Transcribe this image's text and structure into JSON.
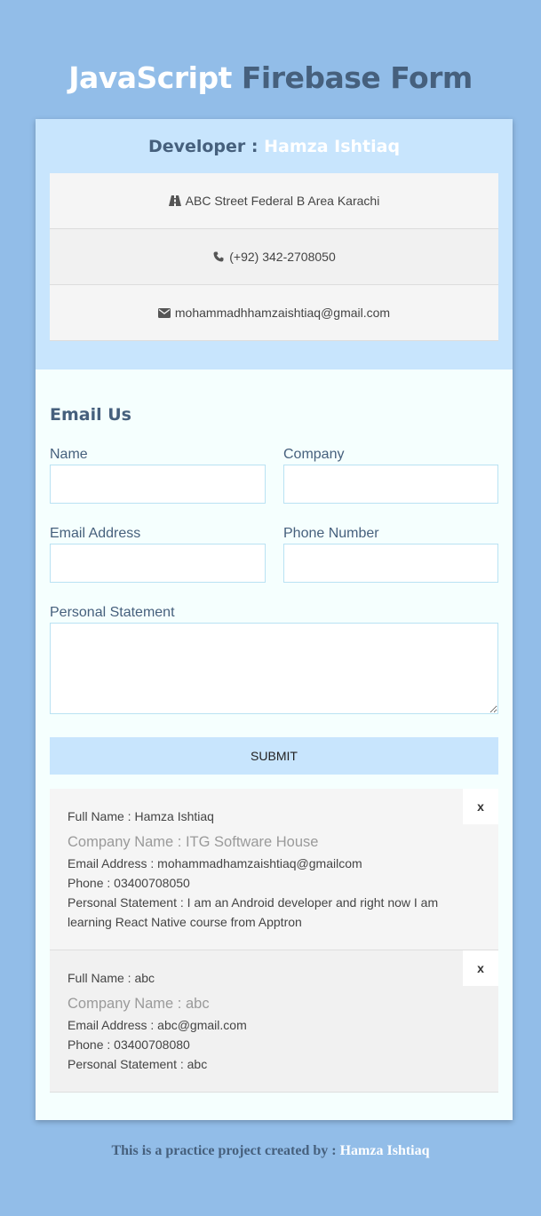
{
  "header": {
    "title_part1": "JavaScript",
    "title_part2": "Firebase Form"
  },
  "developer": {
    "label": "Developer : ",
    "name": "Hamza Ishtiaq",
    "address": "ABC Street Federal B Area Karachi",
    "address_icon": "road-icon",
    "phone": "(+92) 342-2708050",
    "phone_icon": "phone-icon",
    "email": "mohammadhhamzaishtiaq@gmail.com",
    "email_icon": "envelope-icon"
  },
  "form": {
    "title": "Email Us",
    "name_label": "Name",
    "name_value": "",
    "company_label": "Company",
    "company_value": "",
    "email_label": "Email Address",
    "email_value": "",
    "phone_label": "Phone Number",
    "phone_value": "",
    "statement_label": "Personal Statement",
    "statement_value": "",
    "submit_label": "SUBMIT"
  },
  "entries": [
    {
      "full_name": "Full Name : Hamza Ishtiaq",
      "company": "Company Name : ITG Software House",
      "email": "Email Address : mohammadhamzaishtiaq@gmailcom",
      "phone": "Phone : 03400708050",
      "statement_line1": "Personal Statement : I am an Android developer and right now I am",
      "statement_line2": "learning React Native course from Apptron",
      "close_label": "x"
    },
    {
      "full_name": "Full Name : abc",
      "company": "Company Name : abc",
      "email": "Email Address : abc@gmail.com",
      "phone": "Phone : 03400708080",
      "statement_line1": "Personal Statement : abc",
      "close_label": "x"
    }
  ],
  "footer": {
    "text": "This is a practice project created by : ",
    "name": "Hamza Ishtiaq"
  },
  "colors": {
    "page_bg": "#92bde8",
    "panel_blue": "#c8e5fd",
    "heading": "#46607d",
    "card_bg": "#f5fffe"
  }
}
